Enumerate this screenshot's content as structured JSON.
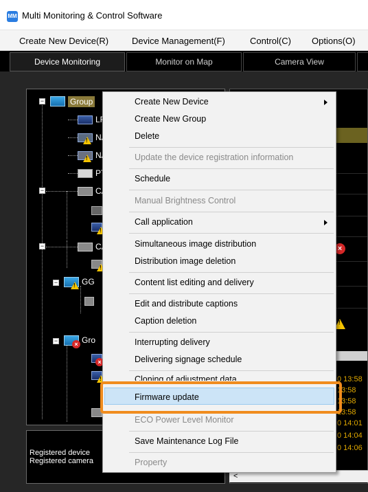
{
  "window": {
    "title": "Multi Monitoring & Control Software",
    "app_icon_text": "MM"
  },
  "menubar": [
    "Create New Device(R)",
    "Device Management(F)",
    "Control(C)",
    "Options(O)"
  ],
  "tabs": [
    "Device Monitoring",
    "Monitor on Map",
    "Camera View"
  ],
  "tree": {
    "root_label": "Group",
    "nodes": [
      "LFX",
      "NA",
      "NA",
      "PT-",
      "CA",
      "CA",
      "GG",
      "Gro"
    ]
  },
  "info": {
    "registered_devices": "Registered device",
    "registered_cameras": "Registered camera"
  },
  "log_times": [
    "0 13:58",
    "13:58",
    "13:58",
    "13:58",
    "0 14:01",
    "0 14:04",
    "0 14:06"
  ],
  "context_menu": {
    "create_new_device": "Create New Device",
    "create_new_group": "Create New Group",
    "delete": "Delete",
    "update_registration": "Update the device registration information",
    "schedule": "Schedule",
    "manual_brightness": "Manual Brightness Control",
    "call_application": "Call application",
    "simultaneous_distribution": "Simultaneous image distribution",
    "distribution_deletion": "Distribution image deletion",
    "content_list": "Content list editing and delivery",
    "edit_captions": "Edit and distribute captions",
    "caption_deletion": "Caption deletion",
    "interrupting_delivery": "Interrupting delivery",
    "signage_schedule": "Delivering signage schedule",
    "cloning": "Cloning of adjustment data",
    "firmware_update": "Firmware update",
    "eco_power": "ECO Power Level Monitor",
    "save_log": "Save Maintenance Log File",
    "property": "Property"
  },
  "colors": {
    "highlight": "#cce4f7",
    "callout": "#f08c1e",
    "group_bg": "#8a7a3a"
  }
}
